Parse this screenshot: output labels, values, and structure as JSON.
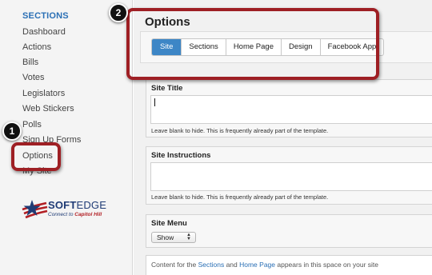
{
  "sidebar": {
    "heading": "SECTIONS",
    "items": [
      {
        "label": "Dashboard"
      },
      {
        "label": "Actions"
      },
      {
        "label": "Bills"
      },
      {
        "label": "Votes"
      },
      {
        "label": "Legislators"
      },
      {
        "label": "Web Stickers"
      },
      {
        "label": "Polls"
      },
      {
        "label": "Sign Up Forms"
      },
      {
        "label": "Options"
      },
      {
        "label": "My Site"
      }
    ],
    "logo": {
      "word_bold": "SOFT",
      "word_rest": "EDGE",
      "tagline_prefix": "Connect to ",
      "tagline_emphasis": "Capitol Hill",
      "colors": {
        "navy": "#1f3b75",
        "red": "#b21f24"
      }
    }
  },
  "main": {
    "title": "Options",
    "tabs": [
      {
        "label": "Site",
        "active": true
      },
      {
        "label": "Sections",
        "active": false
      },
      {
        "label": "Home Page",
        "active": false
      },
      {
        "label": "Design",
        "active": false
      },
      {
        "label": "Facebook App",
        "active": false
      }
    ],
    "site_title": {
      "label": "Site Title",
      "value": "",
      "help": "Leave blank to hide. This is frequently already part of the template."
    },
    "site_instructions": {
      "label": "Site Instructions",
      "value": "",
      "help": "Leave blank to hide. This is frequently already part of the template."
    },
    "site_menu": {
      "label": "Site Menu",
      "selected": "Show"
    },
    "content_note": {
      "prefix": "Content for the ",
      "link1": "Sections",
      "middle": " and ",
      "link2": "Home Page",
      "suffix": " appears in this space on your site"
    }
  },
  "callouts": [
    {
      "number": "1"
    },
    {
      "number": "2"
    }
  ],
  "colors": {
    "accent_blue": "#3d86c6",
    "link_blue": "#2a6fb5",
    "callout_red": "#9e1f24"
  }
}
